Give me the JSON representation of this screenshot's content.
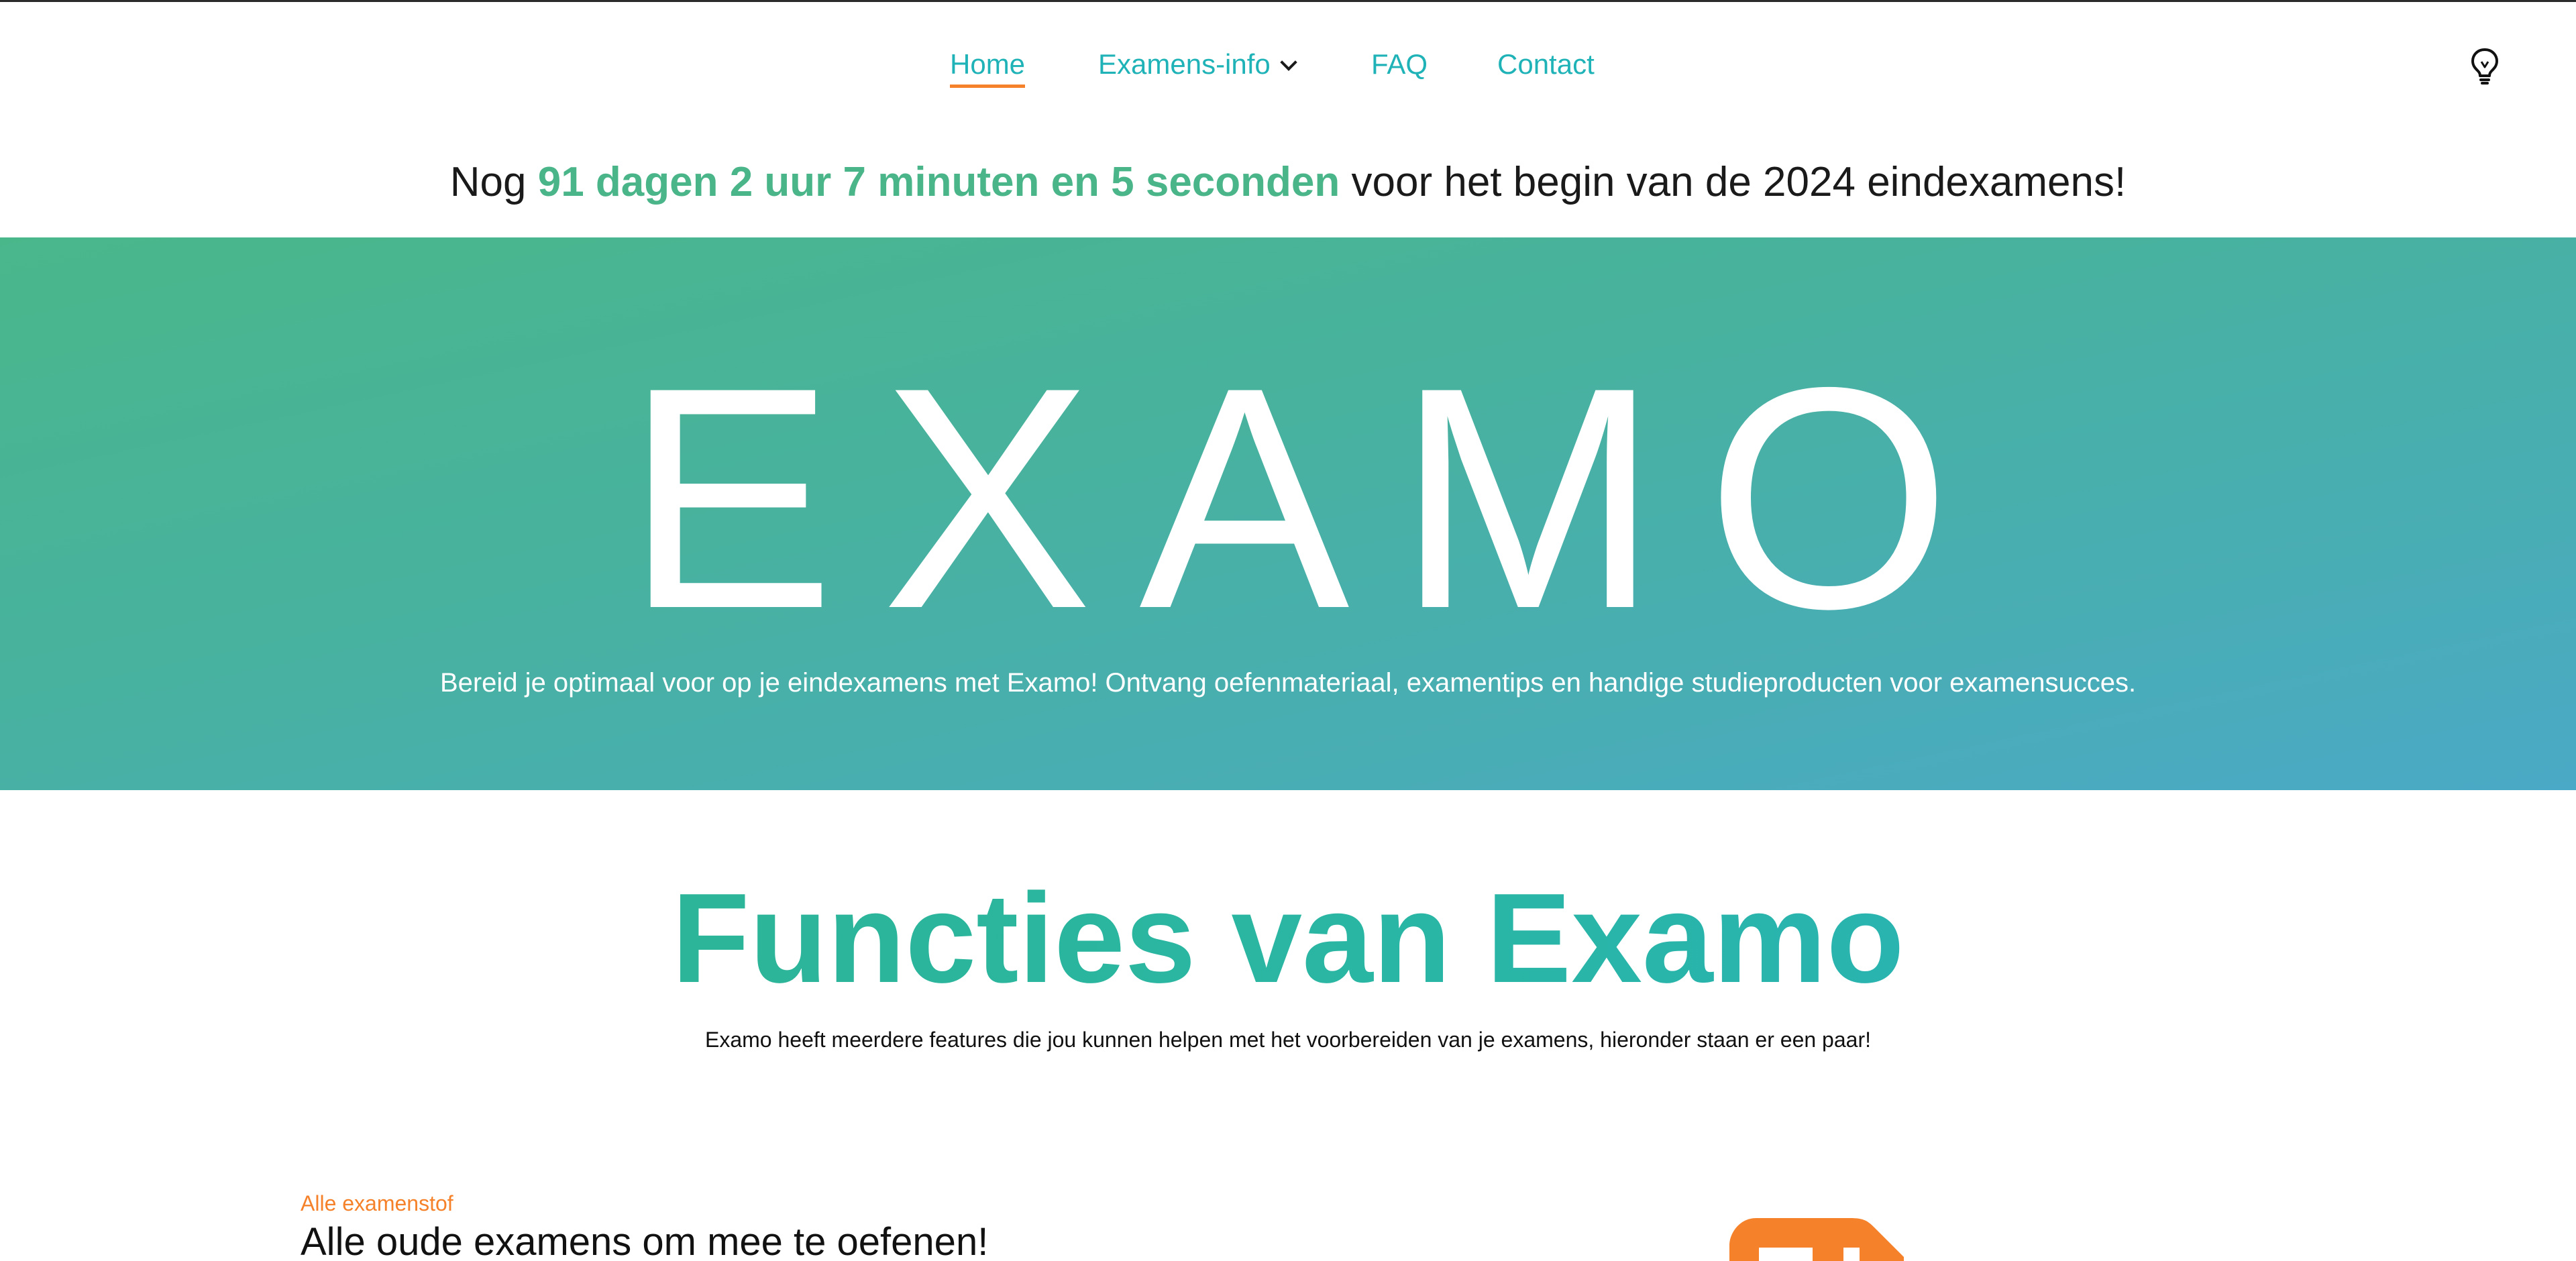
{
  "nav": {
    "items": [
      {
        "label": "Home",
        "active": true
      },
      {
        "label": "Examens-info",
        "has_dropdown": true
      },
      {
        "label": "FAQ"
      },
      {
        "label": "Contact"
      }
    ],
    "theme_toggle_icon": "lightbulb-icon"
  },
  "countdown": {
    "prefix": "Nog",
    "time": "91 dagen 2 uur 7 minuten en 5 seconden",
    "suffix": "voor het begin van de 2024 eindexamens!"
  },
  "hero": {
    "title": "EXAMO",
    "subtitle": "Bereid je optimaal voor op je eindexamens met Examo! Ontvang oefenmateriaal, examentips en handige studieproducten voor examensucces."
  },
  "features": {
    "title": "Functies van Examo",
    "subtitle": "Examo heeft meerdere features die jou kunnen helpen met het voorbereiden van je examens, hieronder staan er een paar!",
    "items": [
      {
        "eyebrow": "Alle examenstof",
        "heading": "Alle oude examens om mee te oefenen!",
        "icon": "document-icon"
      }
    ]
  },
  "colors": {
    "accent_teal": "#1fb3b8",
    "accent_green": "#4bb58a",
    "accent_orange": "#f5822a"
  }
}
